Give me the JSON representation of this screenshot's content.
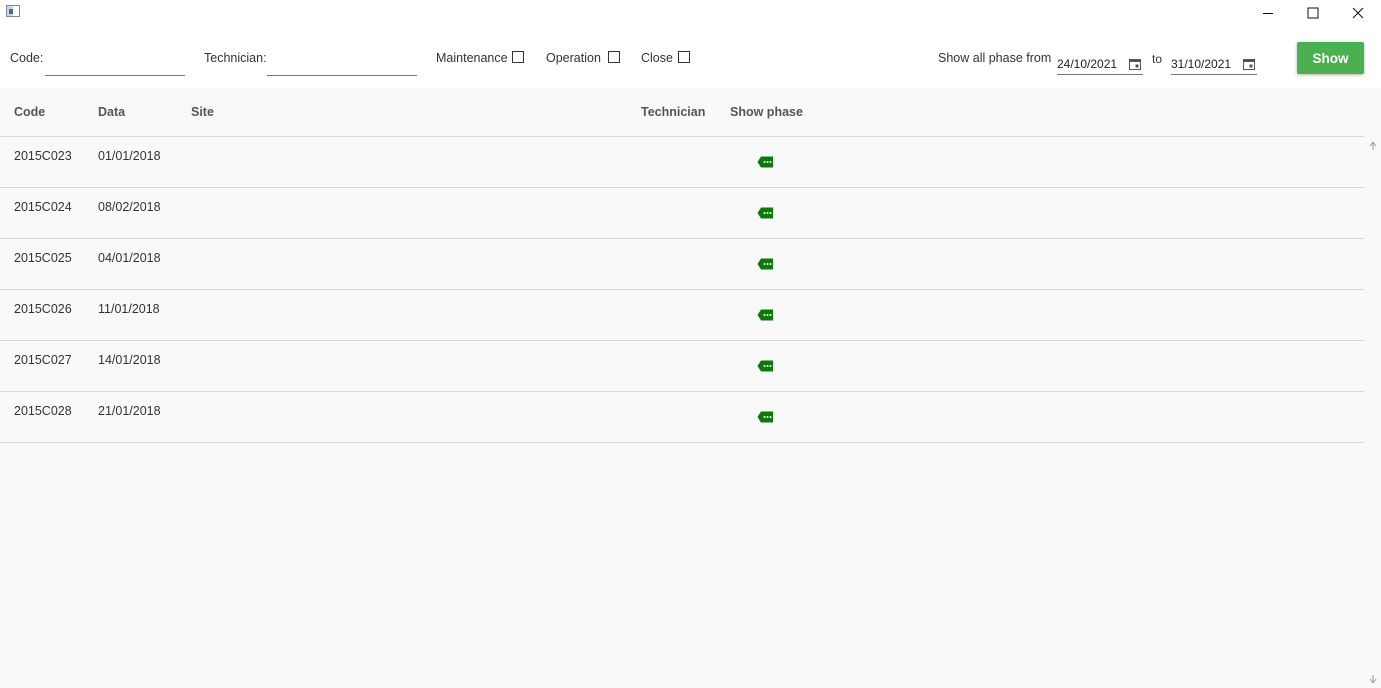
{
  "window": {
    "icon": "app-window-icon",
    "controls": [
      "minimize-icon",
      "maximize-icon",
      "close-icon"
    ]
  },
  "filters": {
    "code_label": "Code:",
    "code_value": "",
    "technician_label": "Technician:",
    "technician_value": "",
    "maintenance_label": "Maintenance",
    "maintenance_checked": false,
    "operation_label": "Operation",
    "operation_checked": false,
    "close_label": "Close",
    "close_checked": false,
    "range_label": "Show all phase from",
    "date_from": "24/10/2021",
    "to_label": "to",
    "date_to": "31/10/2021",
    "show_button": "Show"
  },
  "table": {
    "columns": [
      "Code",
      "Data",
      "Site",
      "Technician",
      "Show phase"
    ],
    "rows": [
      {
        "code": "2015C023",
        "data": "01/01/2018",
        "site": "",
        "technician": ""
      },
      {
        "code": "2015C024",
        "data": "08/02/2018",
        "site": "",
        "technician": ""
      },
      {
        "code": "2015C025",
        "data": "04/01/2018",
        "site": "",
        "technician": ""
      },
      {
        "code": "2015C026",
        "data": "11/01/2018",
        "site": "",
        "technician": ""
      },
      {
        "code": "2015C027",
        "data": "14/01/2018",
        "site": "",
        "technician": ""
      },
      {
        "code": "2015C028",
        "data": "21/01/2018",
        "site": "",
        "technician": ""
      }
    ],
    "phase_icon": "tag-more-icon"
  },
  "colors": {
    "accent": "#4caf50",
    "icon_green": "#0b7a0b",
    "grid_background": "#f9f9f9"
  }
}
